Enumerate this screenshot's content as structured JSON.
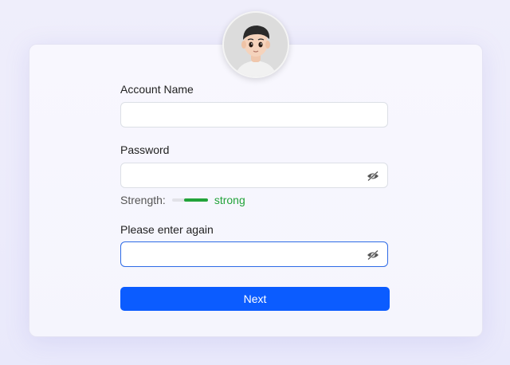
{
  "form": {
    "account_label": "Account Name",
    "account_value": "",
    "password_label": "Password",
    "password_value": "",
    "strength_label": "Strength:",
    "strength_value": "strong",
    "strength_level": 0.67,
    "confirm_label": "Please enter again",
    "confirm_value": "",
    "next_label": "Next"
  },
  "colors": {
    "primary": "#0b5cff",
    "strength_strong": "#22a33a",
    "focus_border": "#2e6be6"
  },
  "icons": {
    "avatar": "user-avatar",
    "toggle_visibility": "eye-off-icon"
  }
}
